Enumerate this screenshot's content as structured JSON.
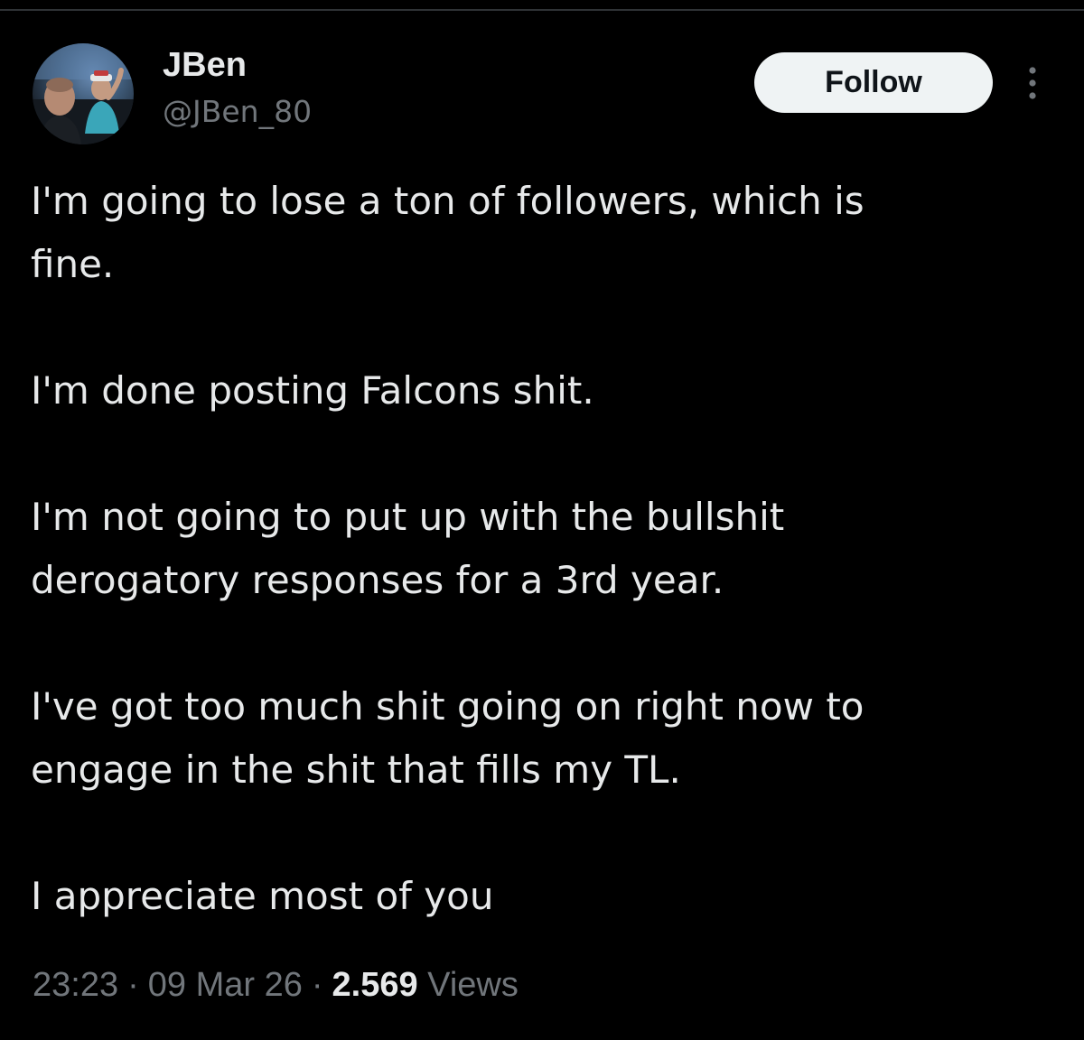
{
  "author": {
    "display_name": "JBen",
    "handle": "@JBen_80"
  },
  "actions": {
    "follow_label": "Follow",
    "more_icon": "more-vertical-icon"
  },
  "tweet": {
    "paragraphs": [
      "I'm going to lose a ton of followers, which is\nfine.",
      "I'm done posting Falcons shit.",
      "I'm not going to put up with the bullshit\nderogatory responses for a 3rd year.",
      "I've got too much shit going on right now to\nengage in the shit that fills my TL.",
      "I appreciate most of you"
    ]
  },
  "meta": {
    "time": "23:23",
    "separator": "·",
    "date": "09 Mar 26",
    "views_count": "2.569",
    "views_label": "Views"
  },
  "colors": {
    "background": "#000000",
    "text_primary": "#e7e9ea",
    "text_secondary": "#71767b",
    "follow_bg": "#eff3f4",
    "divider": "#2f3336"
  }
}
